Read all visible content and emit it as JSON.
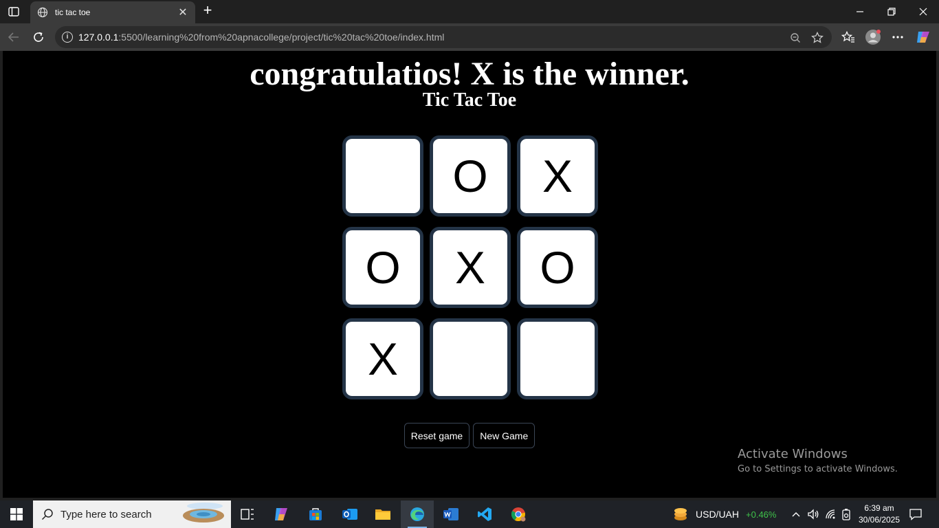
{
  "browser": {
    "tab": {
      "title": "tic tac toe"
    },
    "new_tab_label": "+",
    "url": {
      "host": "127.0.0.1",
      "rest": ":5500/learning%20from%20apnacollege/project/tic%20tac%20toe/index.html"
    }
  },
  "page": {
    "winner_message": "congratulatios! X is the winner.",
    "title": "Tic Tac Toe",
    "board": [
      "",
      "O",
      "X",
      "O",
      "X",
      "O",
      "X",
      "",
      ""
    ],
    "reset_label": "Reset game",
    "new_game_label": "New Game"
  },
  "watermark": {
    "line1": "Activate Windows",
    "line2": "Go to Settings to activate Windows."
  },
  "taskbar": {
    "search_placeholder": "Type here to search",
    "ticker_name": "USD/UAH",
    "ticker_change": "+0.46%",
    "time": "6:39 am",
    "date": "30/06/2025"
  },
  "colors": {
    "cell_border": "#243447",
    "ticker_positive": "#3fc24a",
    "accent": "#7fb8ea"
  }
}
